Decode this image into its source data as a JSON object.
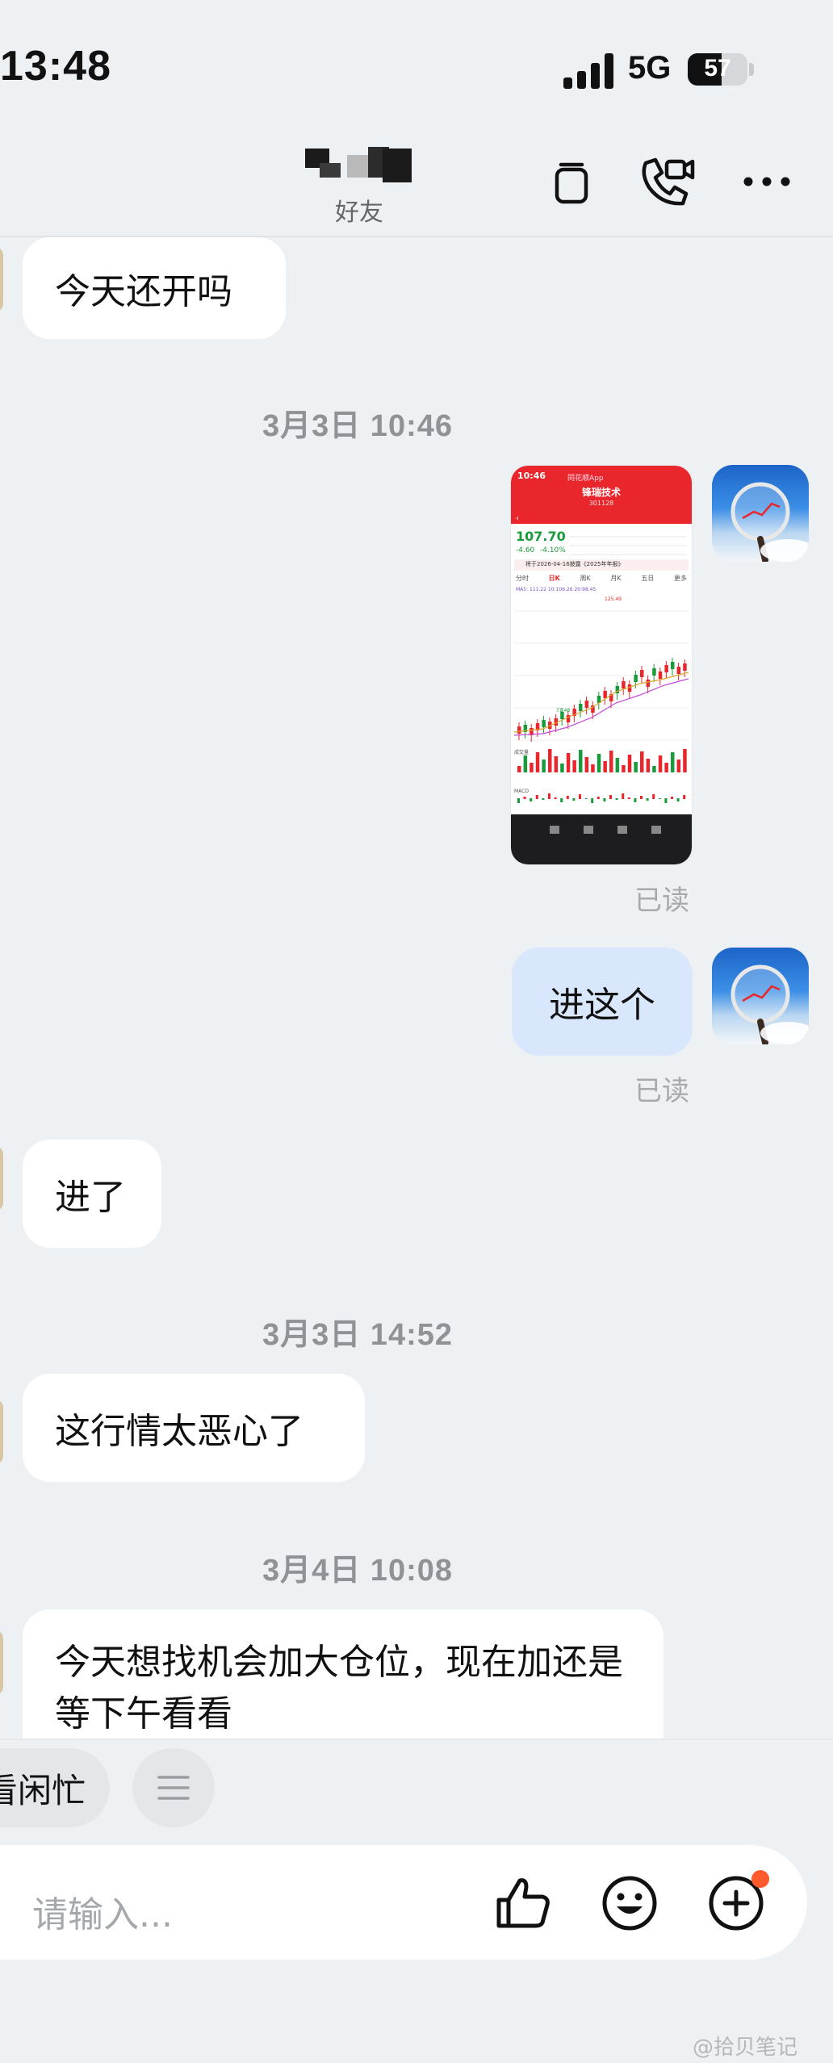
{
  "status_bar": {
    "time": "13:48",
    "network": "5G",
    "battery": "57",
    "battery_level_pct": 57
  },
  "header": {
    "subtitle": "好友",
    "icons": [
      "phone-dock-icon",
      "video-call-icon",
      "more-icon"
    ]
  },
  "messages": [
    {
      "from": "peer",
      "text": "今天还开吗"
    },
    {
      "type": "timestamp",
      "text": "3月3日 10:46"
    },
    {
      "from": "me",
      "type": "image",
      "read": "已读",
      "image": {
        "status_time": "10:46",
        "app_name": "同花顺App",
        "stock_name": "锋瑞技术",
        "stock_code": "301128",
        "price": "107.70",
        "change": "-4.60",
        "change_pct": "-4.10%",
        "notice": "将于2026-04-16披露《2025年年报》",
        "period_tabs": [
          "分时",
          "日K",
          "周K",
          "月K",
          "五日",
          "更多"
        ],
        "ma_label": "MA5: 111.22  10:106.26  20:98.45",
        "high_label": "125.49",
        "low_label": "71.48",
        "vol_label": "成交量",
        "macd_label": "MACD"
      }
    },
    {
      "from": "me",
      "text": "进这个",
      "read": "已读"
    },
    {
      "from": "peer",
      "text": "进了"
    },
    {
      "type": "timestamp",
      "text": "3月3日 14:52"
    },
    {
      "from": "peer",
      "text": "这行情太恶心了"
    },
    {
      "type": "timestamp",
      "text": "3月4日 10:08"
    },
    {
      "from": "peer",
      "text": "今天想找机会加大仓位，现在加还是等下午看看"
    }
  ],
  "quick_reply": {
    "chip_label": "看闲忙",
    "menu_icon": "list-icon"
  },
  "composer": {
    "placeholder": "请输入...",
    "icons": [
      "thumbs-up-icon",
      "emoji-icon",
      "add-icon"
    ]
  },
  "watermark": "@拾贝笔记",
  "colors": {
    "background": "#eef1f3",
    "my_bubble": "#d8e7fc",
    "peer_bubble": "#ffffff",
    "stock_red": "#e8262b",
    "stock_green": "#1a9b3b",
    "notify_dot": "#ff5a2c"
  }
}
